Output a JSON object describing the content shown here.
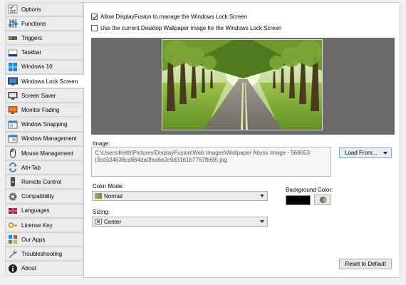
{
  "sidebar": {
    "items": [
      {
        "label": "Options",
        "icon": "options-checklist-icon"
      },
      {
        "label": "Functions",
        "icon": "functions-sliders-icon"
      },
      {
        "label": "Triggers",
        "icon": "triggers-lightning-icon"
      },
      {
        "label": "Taskbar",
        "icon": "taskbar-icon"
      },
      {
        "label": "Windows 10",
        "icon": "windows-logo-icon"
      },
      {
        "label": "Windows Lock Screen",
        "icon": "lock-screen-monitor-icon",
        "active": true
      },
      {
        "label": "Screen Saver",
        "icon": "screen-saver-icon"
      },
      {
        "label": "Monitor Fading",
        "icon": "monitor-fading-icon"
      },
      {
        "label": "Window Snapping",
        "icon": "window-snapping-icon"
      },
      {
        "label": "Window Management",
        "icon": "window-management-icon"
      },
      {
        "label": "Mouse Management",
        "icon": "mouse-icon"
      },
      {
        "label": "Alt+Tab",
        "icon": "alt-tab-arrows-icon"
      },
      {
        "label": "Remote Control",
        "icon": "remote-control-icon"
      },
      {
        "label": "Compatibility",
        "icon": "compatibility-gear-icon"
      },
      {
        "label": "Languages",
        "icon": "languages-flag-icon"
      },
      {
        "label": "License Key",
        "icon": "key-icon"
      },
      {
        "label": "Our Apps",
        "icon": "apps-grid-icon"
      },
      {
        "label": "Troubleshooting",
        "icon": "wrench-icon"
      },
      {
        "label": "About",
        "icon": "info-icon"
      }
    ]
  },
  "lockscreen": {
    "allow_label": "Allow DisplayFusion to manage the Windows Lock Screen",
    "allow_checked": true,
    "use_current_label": "Use the current Desktop Wallpaper image for the Windows Lock Screen",
    "use_current_checked": false,
    "image_label": "Image:",
    "image_path": "C:\\Users\\Keith\\Pictures\\DisplayFusion\\Web Images\\Wallpaper Abyss Image - 568653\n(3cd334638cd864da0fea6e2c9d3161b7767fb69).jpg",
    "load_from_label": "Load From...",
    "color_mode_label": "Color Mode:",
    "color_mode_value": "Normal",
    "sizing_label": "Sizing:",
    "sizing_value": "Center",
    "background_color_label": "Background Color:",
    "background_color_value": "#000000",
    "reset_label": "Reset to Default"
  }
}
